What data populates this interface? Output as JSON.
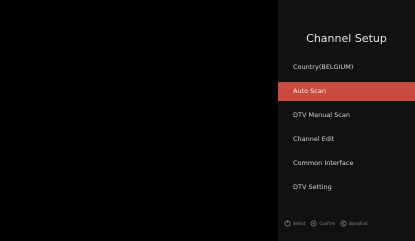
{
  "header": {
    "title": "Channel Setup"
  },
  "menu": {
    "items": [
      {
        "label": "Country(BELGIUM)"
      },
      {
        "label": "Auto Scan",
        "selected": true
      },
      {
        "label": "DTV Manual Scan"
      },
      {
        "label": "Channel Edit"
      },
      {
        "label": "Common Interface"
      },
      {
        "label": "DTV Setting"
      }
    ]
  },
  "footer": {
    "hints": [
      {
        "icon": "power-icon",
        "label": "Select"
      },
      {
        "icon": "ok-icon",
        "label": "Confirm"
      },
      {
        "icon": "back-icon",
        "label": "Back/Exit"
      }
    ]
  },
  "colors": {
    "accent": "#c94a3f",
    "background": "#000000",
    "panel": "#111111"
  }
}
